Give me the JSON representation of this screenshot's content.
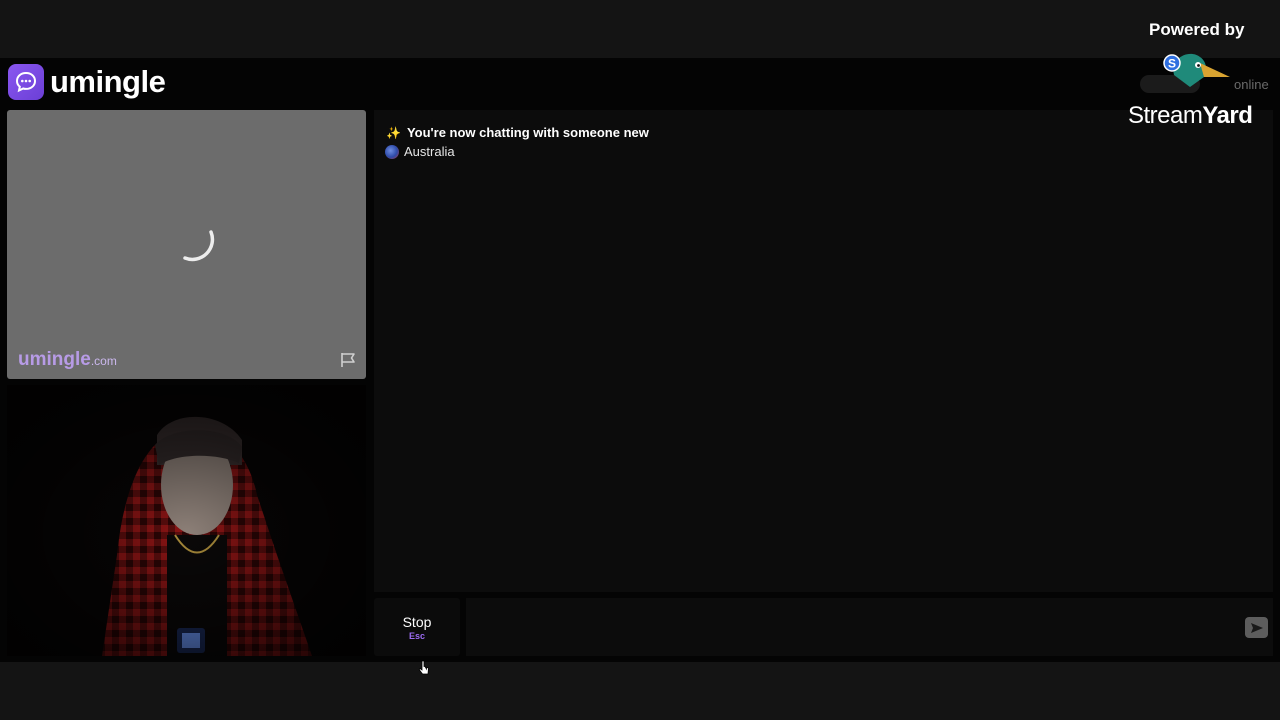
{
  "brand": {
    "name": "umingle"
  },
  "header": {
    "online_label": "online"
  },
  "stranger": {
    "watermark": "umingle",
    "watermark_domain": ".com"
  },
  "chat": {
    "system_message": "You're now chatting with someone new",
    "country": "Australia"
  },
  "controls": {
    "stop_label": "Stop",
    "stop_shortcut": "Esc",
    "message_placeholder": ""
  },
  "overlay": {
    "powered_by": "Powered by",
    "streamyard_light": "Stream",
    "streamyard_bold": "Yard"
  },
  "colors": {
    "accent": "#8a57f0",
    "background": "#040404",
    "video_placeholder": "#6c6c6c"
  },
  "icons": [
    "chat-bubble-icon",
    "loading-spinner-icon",
    "flag-icon",
    "sparkle-icon",
    "globe-icon",
    "send-icon",
    "cursor-icon",
    "streamyard-logo-icon"
  ]
}
